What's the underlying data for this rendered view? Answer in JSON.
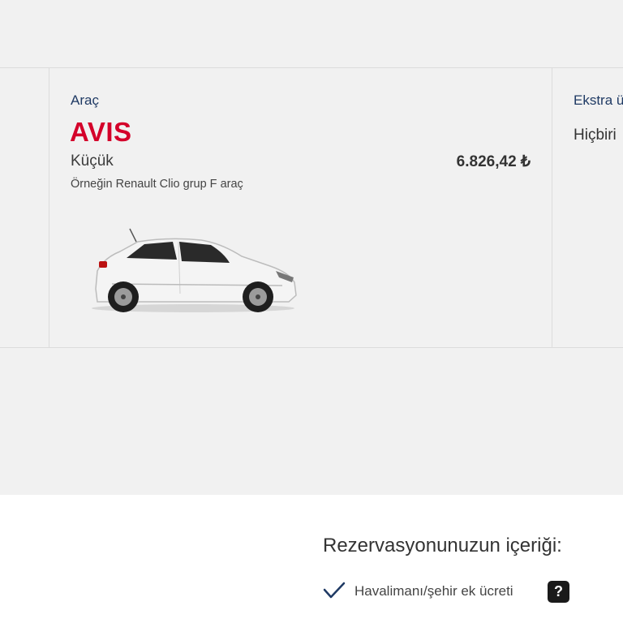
{
  "vehicle": {
    "label": "Araç",
    "brand": "AVIS",
    "class": "Küçük",
    "price": "6.826,42 ₺",
    "example": "Örneğin Renault Clio grup F araç",
    "image_icon": "car-image"
  },
  "extras": {
    "label": "Ekstra ü",
    "value": "Hiçbiri"
  },
  "summary": {
    "title": "Rezervasyonunuzun içeriği:",
    "items": [
      {
        "label": "Havalimanı/şehir ek ücreti",
        "icon": "check-icon",
        "help": "?"
      }
    ]
  },
  "colors": {
    "brand_red": "#d4002a",
    "label_blue": "#1f3a64",
    "panel_gray": "#f1f1f1"
  }
}
